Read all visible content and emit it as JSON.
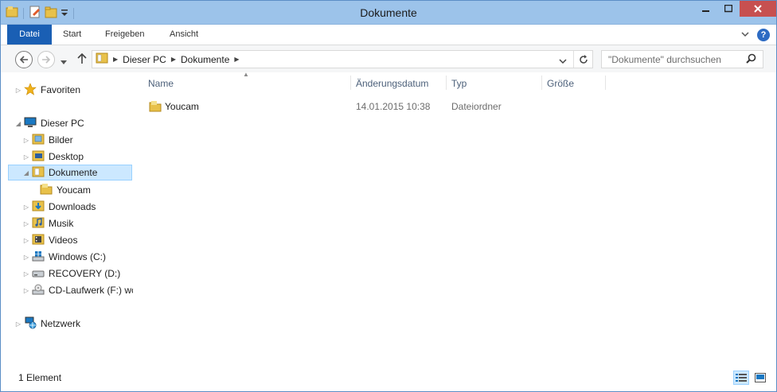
{
  "window": {
    "title": "Dokumente"
  },
  "ribbon": {
    "tabs": [
      {
        "label": "Datei",
        "active": true
      },
      {
        "label": "Start"
      },
      {
        "label": "Freigeben"
      },
      {
        "label": "Ansicht"
      }
    ]
  },
  "address": {
    "segments": [
      "Dieser PC",
      "Dokumente"
    ]
  },
  "search": {
    "placeholder": "\"Dokumente\" durchsuchen"
  },
  "navpane": {
    "favorites": "Favoriten",
    "this_pc": "Dieser PC",
    "items": [
      {
        "label": "Bilder",
        "icon": "pictures-folder-icon"
      },
      {
        "label": "Desktop",
        "icon": "desktop-folder-icon"
      },
      {
        "label": "Dokumente",
        "icon": "documents-folder-icon",
        "selected": true
      },
      {
        "label": "Youcam",
        "icon": "folder-icon",
        "child": true
      },
      {
        "label": "Downloads",
        "icon": "downloads-folder-icon"
      },
      {
        "label": "Musik",
        "icon": "music-folder-icon"
      },
      {
        "label": "Videos",
        "icon": "videos-folder-icon"
      },
      {
        "label": "Windows (C:)",
        "icon": "windows-drive-icon"
      },
      {
        "label": "RECOVERY (D:)",
        "icon": "drive-icon"
      },
      {
        "label": "CD-Laufwerk (F:) wc",
        "icon": "cd-drive-icon"
      }
    ],
    "network": "Netzwerk"
  },
  "table": {
    "columns": [
      "Name",
      "Änderungsdatum",
      "Typ",
      "Größe"
    ],
    "rows": [
      {
        "name": "Youcam",
        "date": "14.01.2015 10:38",
        "type": "Dateiordner",
        "size": ""
      }
    ]
  },
  "status": {
    "count": "1 Element"
  },
  "colors": {
    "accent": "#1a5fb4",
    "titlebar": "#9cc3ea",
    "close": "#c75050",
    "selection": "#cce8ff"
  }
}
